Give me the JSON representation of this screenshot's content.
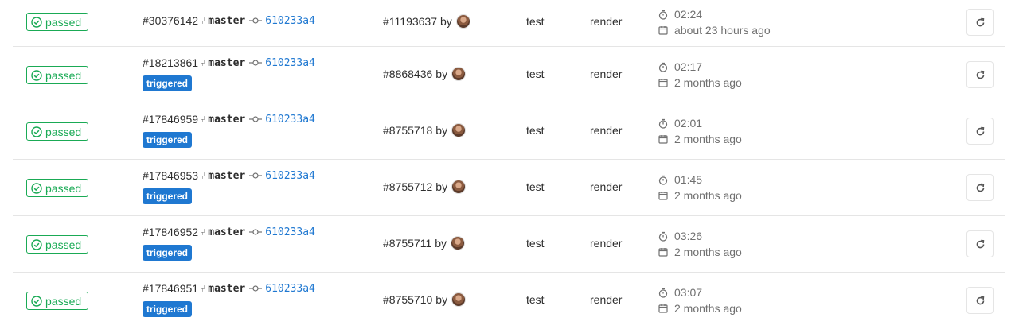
{
  "colors": {
    "success": "#1aaa55",
    "link": "#1f78d1",
    "muted": "#707070",
    "border": "#e5e5e5"
  },
  "icons": {
    "status": "check-circle-icon",
    "branch": "branch-icon",
    "commit": "commit-icon",
    "duration": "stopwatch-icon",
    "date": "calendar-icon",
    "retry": "retry-icon"
  },
  "jobs": [
    {
      "status": "passed",
      "job_id": "#30376142",
      "branch": "master",
      "commit": "610233a4",
      "triggered": "",
      "pipeline": "#11193637",
      "by": "by",
      "stage": "test",
      "name": "render",
      "duration": "02:24",
      "finished": "about 23 hours ago"
    },
    {
      "status": "passed",
      "job_id": "#18213861",
      "branch": "master",
      "commit": "610233a4",
      "triggered": "triggered",
      "pipeline": "#8868436",
      "by": "by",
      "stage": "test",
      "name": "render",
      "duration": "02:17",
      "finished": "2 months ago"
    },
    {
      "status": "passed",
      "job_id": "#17846959",
      "branch": "master",
      "commit": "610233a4",
      "triggered": "triggered",
      "pipeline": "#8755718",
      "by": "by",
      "stage": "test",
      "name": "render",
      "duration": "02:01",
      "finished": "2 months ago"
    },
    {
      "status": "passed",
      "job_id": "#17846953",
      "branch": "master",
      "commit": "610233a4",
      "triggered": "triggered",
      "pipeline": "#8755712",
      "by": "by",
      "stage": "test",
      "name": "render",
      "duration": "01:45",
      "finished": "2 months ago"
    },
    {
      "status": "passed",
      "job_id": "#17846952",
      "branch": "master",
      "commit": "610233a4",
      "triggered": "triggered",
      "pipeline": "#8755711",
      "by": "by",
      "stage": "test",
      "name": "render",
      "duration": "03:26",
      "finished": "2 months ago"
    },
    {
      "status": "passed",
      "job_id": "#17846951",
      "branch": "master",
      "commit": "610233a4",
      "triggered": "triggered",
      "pipeline": "#8755710",
      "by": "by",
      "stage": "test",
      "name": "render",
      "duration": "03:07",
      "finished": "2 months ago"
    }
  ]
}
